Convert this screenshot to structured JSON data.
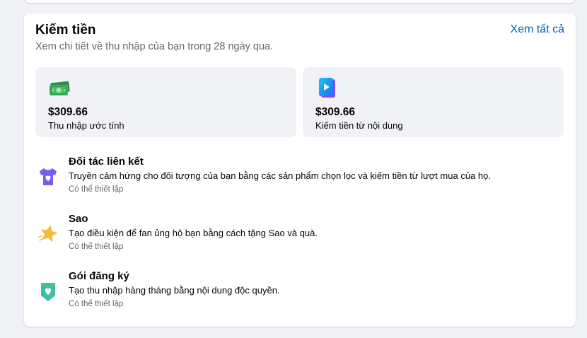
{
  "monetization": {
    "title": "Kiếm tiền",
    "subtitle": "Xem chi tiết về thu nhập của bạn trong 28 ngày qua.",
    "see_all": "Xem tất cả",
    "stats": [
      {
        "icon": "money-icon",
        "value": "$309.66",
        "label": "Thu nhập ước tính"
      },
      {
        "icon": "video-play-icon",
        "value": "$309.66",
        "label": "Kiếm tiền từ nội dung"
      }
    ],
    "features": [
      {
        "icon": "shirt-heart-icon",
        "title": "Đối tác liên kết",
        "description": "Truyền cảm hứng cho đối tượng của bạn bằng các sản phẩm chọn lọc và kiếm tiền từ lượt mua của họ.",
        "status": "Có thể thiết lập"
      },
      {
        "icon": "star-icon",
        "title": "Sao",
        "description": "Tạo điều kiện để fan ủng hộ bạn bằng cách tặng Sao và quà.",
        "status": "Có thể thiết lập"
      },
      {
        "icon": "heart-shield-icon",
        "title": "Gói đăng ký",
        "description": "Tạo thu nhập hàng tháng bằng nội dung độc quyền.",
        "status": "Có thể thiết lập"
      }
    ]
  }
}
